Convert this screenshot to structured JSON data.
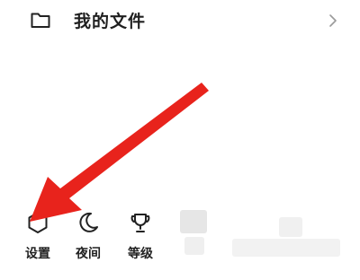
{
  "menu_row": {
    "icon": "folder-icon",
    "label": "我的文件",
    "chevron": "chevron-right-icon"
  },
  "toolbar": {
    "items": [
      {
        "icon": "hexagon-settings-icon",
        "label": "设置"
      },
      {
        "icon": "moon-icon",
        "label": "夜间"
      },
      {
        "icon": "trophy-icon",
        "label": "等级"
      }
    ]
  },
  "annotation": {
    "arrow_color": "#e8231c",
    "icon": "red-pointer-arrow"
  }
}
